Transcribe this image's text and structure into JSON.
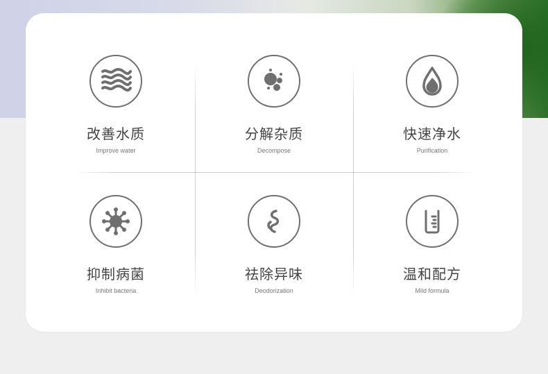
{
  "features": [
    {
      "title": "改善水质",
      "subtitle": "Improve water",
      "icon": "water-waves-icon"
    },
    {
      "title": "分解杂质",
      "subtitle": "Decompose",
      "icon": "particles-icon"
    },
    {
      "title": "快速净水",
      "subtitle": "Purification",
      "icon": "water-drop-icon"
    },
    {
      "title": "抑制病菌",
      "subtitle": "Inhibit bacteria",
      "icon": "germ-icon"
    },
    {
      "title": "祛除异味",
      "subtitle": "Deodorization",
      "icon": "odor-smoke-icon"
    },
    {
      "title": "温和配方",
      "subtitle": "Mild formula",
      "icon": "beaker-icon"
    }
  ],
  "colors": {
    "icon_stroke": "#6f6f6f",
    "text_primary": "#444444",
    "text_secondary": "#777777",
    "card_bg": "#ffffff",
    "page_bg": "#efefef"
  }
}
